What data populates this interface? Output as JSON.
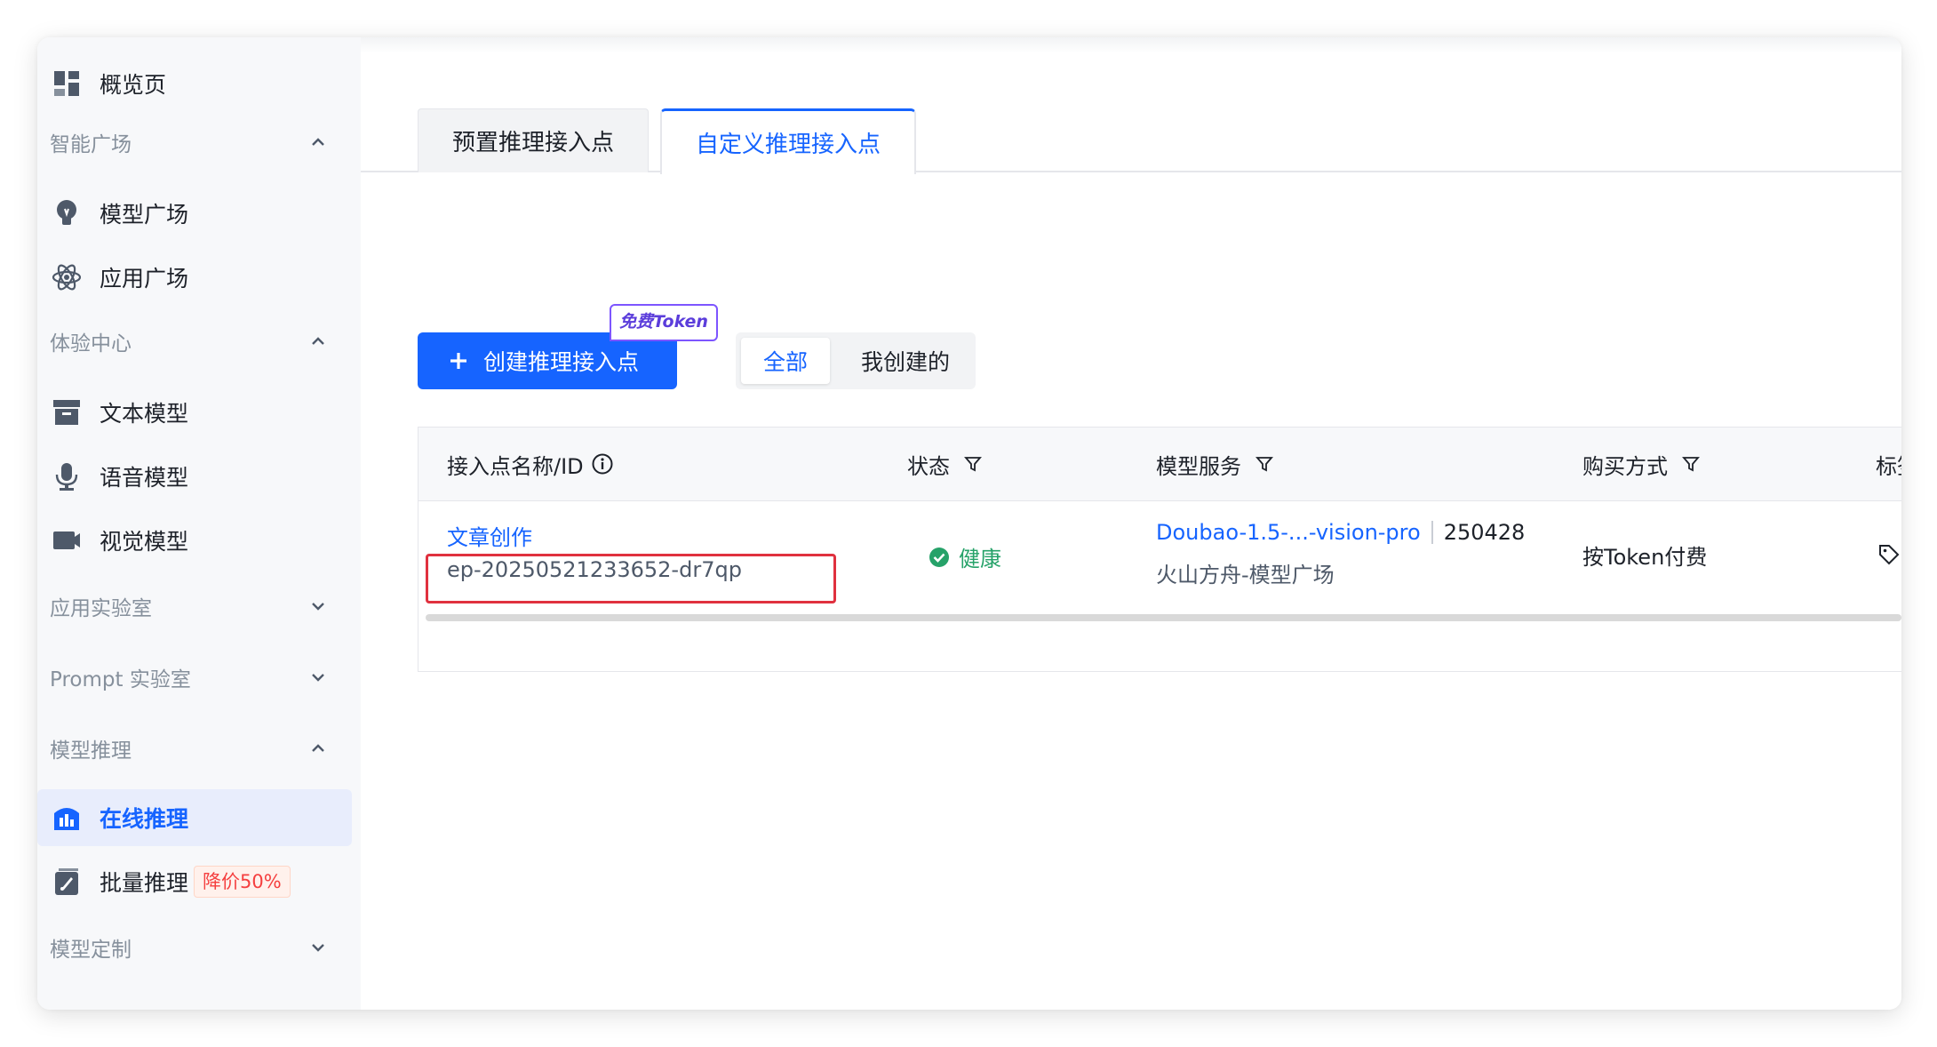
{
  "sidebar": {
    "overview": {
      "label": "概览页",
      "icon": "dashboard-icon"
    },
    "sections": {
      "smart_plaza": "智能广场",
      "experience_center": "体验中心",
      "app_lab": "应用实验室",
      "prompt_lab": "Prompt 实验室",
      "model_inference": "模型推理",
      "model_custom": "模型定制"
    },
    "items": {
      "model_plaza": "模型广场",
      "app_plaza": "应用广场",
      "text_model": "文本模型",
      "voice_model": "语音模型",
      "vision_model": "视觉模型",
      "online_inference": "在线推理",
      "batch_inference": "批量推理",
      "batch_badge": "降价50%"
    }
  },
  "tabs": {
    "preset": "预置推理接入点",
    "custom": "自定义推理接入点"
  },
  "toolbar": {
    "create_label": "创建推理接入点",
    "free_badge": "免费Token",
    "filter_all": "全部",
    "filter_mine": "我创建的"
  },
  "table": {
    "headers": {
      "name": "接入点名称/ID",
      "status": "状态",
      "model": "模型服务",
      "billing": "购买方式",
      "tags": "标签"
    },
    "rows": [
      {
        "name": "文章创作",
        "id": "ep-20250521233652-dr7qp",
        "status": "健康",
        "model_name": "Doubao-1.5-...-vision-pro",
        "model_version": "250428",
        "model_source": "火山方舟-模型广场",
        "billing": "按Token付费"
      }
    ]
  },
  "colors": {
    "accent": "#1664ff",
    "success": "#26a269",
    "highlight_box": "#e0313f",
    "discount": "#f53f3f"
  }
}
